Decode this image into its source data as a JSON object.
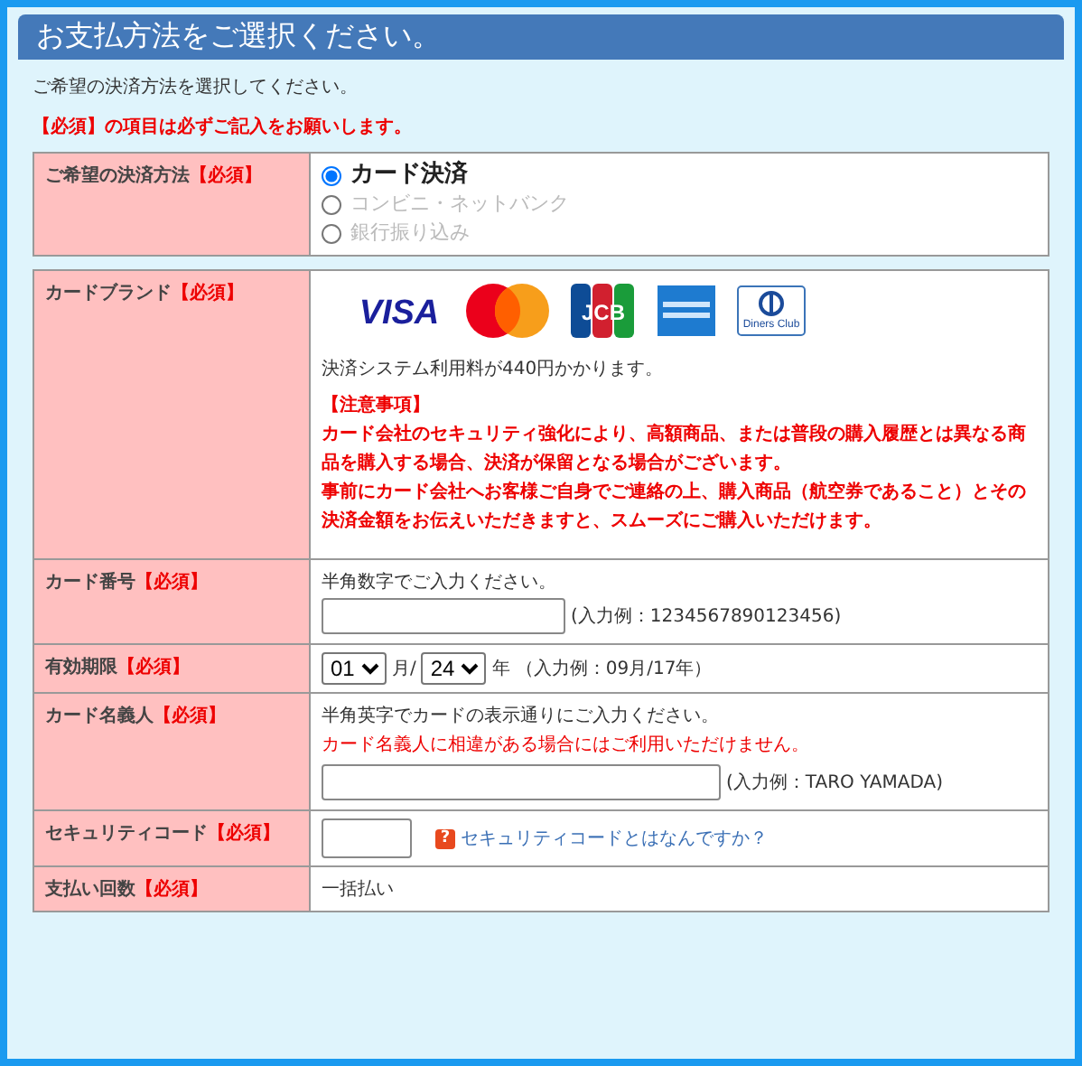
{
  "title": "お支払方法をご選択ください。",
  "intro": "ご希望の決済方法を選択してください。",
  "required_note": "【必須】の項目は必ずご記入をお願いします。",
  "method": {
    "label": "ご希望の決済方法",
    "required": "【必須】",
    "options": [
      {
        "label": "カード決済",
        "selected": true
      },
      {
        "label": "コンビニ・ネットバンク",
        "selected": false
      },
      {
        "label": "銀行振り込み",
        "selected": false
      }
    ]
  },
  "rows": [
    {
      "kind": "brands",
      "label": "カードブランド",
      "required": "【必須】",
      "brands": [
        {
          "kind": "visa",
          "label": "VISA"
        },
        {
          "kind": "mastercard"
        },
        {
          "kind": "jcb",
          "label": "JCB"
        },
        {
          "kind": "amex"
        },
        {
          "kind": "diners",
          "label": "Diners Club"
        }
      ],
      "fee": "決済システム利用料が440円かかります。",
      "notice_title": "【注意事項】",
      "notice": [
        "カード会社のセキュリティ強化により、高額商品、または普段の購入履歴とは異なる商品を購入する場合、決済が保留となる場合がございます。",
        "事前にカード会社へお客様ご自身でご連絡の上、購入商品（航空券であること）とその決済金額をお伝えいただきますと、スムーズにご購入いただけます。"
      ]
    },
    {
      "kind": "number",
      "label": "カード番号",
      "required": "【必須】",
      "hint": "半角数字でご入力ください。",
      "example": "(入力例：1234567890123456)"
    },
    {
      "kind": "expiry",
      "label": "有効期限",
      "required": "【必須】",
      "month": "01",
      "month_unit": "月/",
      "year": "24",
      "year_unit": "年",
      "example": "（入力例：09月/17年）"
    },
    {
      "kind": "name",
      "label": "カード名義人",
      "required": "【必須】",
      "hint": "半角英字でカードの表示通りにご入力ください。",
      "warning": "カード名義人に相違がある場合にはご利用いただけません。",
      "example": "(入力例：TARO YAMADA)"
    },
    {
      "kind": "security",
      "label": "セキュリティコード",
      "required": "【必須】",
      "help_icon": "?",
      "link": "セキュリティコードとはなんですか？"
    },
    {
      "kind": "installments",
      "label": "支払い回数",
      "required": "【必須】",
      "value": "一括払い"
    }
  ]
}
